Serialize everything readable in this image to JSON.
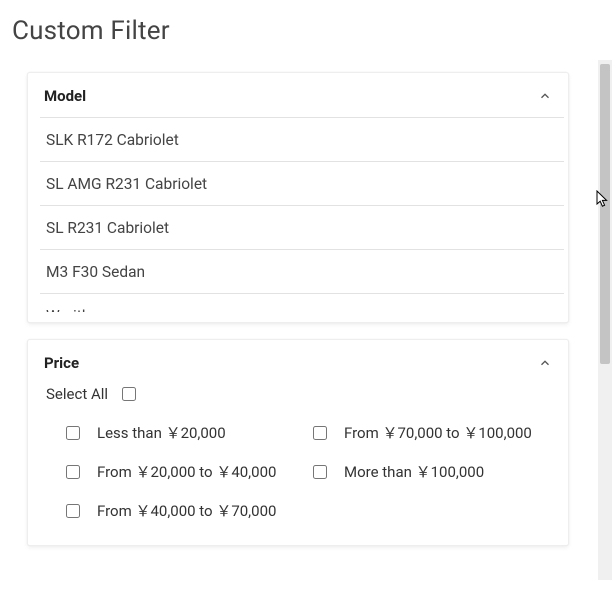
{
  "page_title": "Custom Filter",
  "sections": {
    "model": {
      "header": "Model",
      "items": [
        "SLK R172 Cabriolet",
        "SL AMG R231 Cabriolet",
        "SL R231 Cabriolet",
        "M3 F30 Sedan",
        "Wraith"
      ]
    },
    "price": {
      "header": "Price",
      "select_all_label": "Select All",
      "options": [
        "Less than ￥20,000",
        "From ￥70,000 to ￥100,000",
        "From ￥20,000 to ￥40,000",
        "More than ￥100,000",
        "From ￥40,000 to ￥70,000"
      ]
    }
  }
}
